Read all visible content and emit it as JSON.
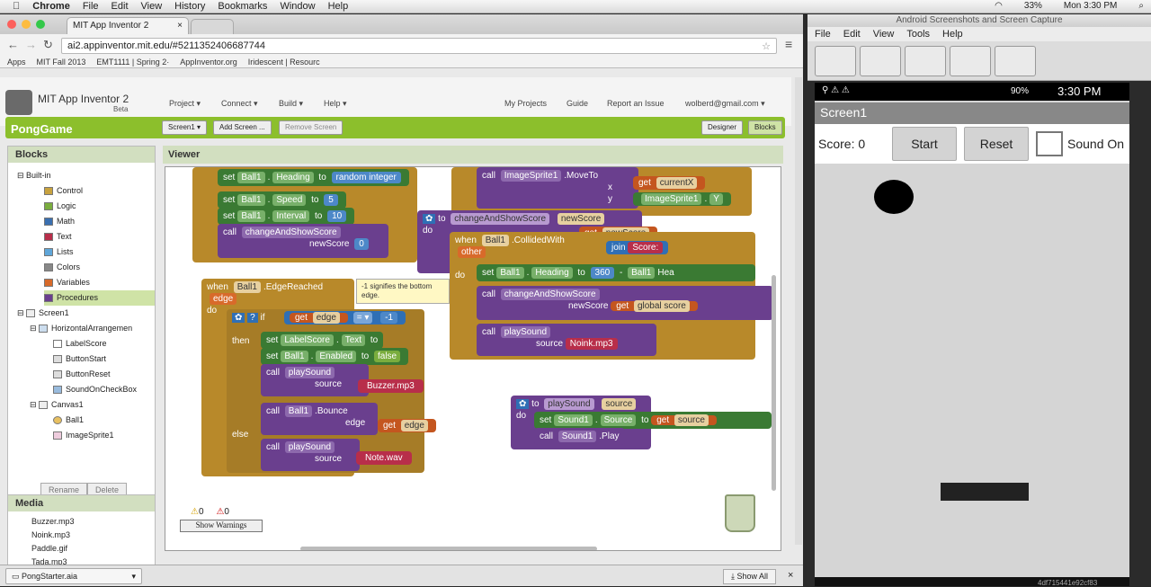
{
  "menubar": {
    "app": "Chrome",
    "items": [
      "File",
      "Edit",
      "View",
      "History",
      "Bookmarks",
      "Window",
      "Help"
    ],
    "battery": "33%",
    "clock": "Mon 3:30 PM"
  },
  "browser": {
    "tab_title": "MIT App Inventor 2",
    "url": "ai2.appinventor.mit.edu/#5211352406687744",
    "bookmarks": [
      "Apps",
      "MIT Fall 2013",
      "EMT1111 | Spring 2·",
      "AppInventor.org",
      "Iridescent | Resourc"
    ],
    "download_file": "PongStarter.aia",
    "show_all": "Show All"
  },
  "ai": {
    "title": "MIT App Inventor 2",
    "beta": "Beta",
    "menus": [
      "Project ▾",
      "Connect ▾",
      "Build ▾",
      "Help ▾"
    ],
    "right_links": [
      "My Projects",
      "Guide",
      "Report an Issue",
      "wolberd@gmail.com ▾"
    ],
    "project": "PongGame",
    "screen_dd": "Screen1 ▾",
    "add_screen": "Add Screen ...",
    "remove_screen": "Remove Screen",
    "designer": "Designer",
    "blocks": "Blocks"
  },
  "blocks_panel": {
    "title": "Blocks",
    "builtin": "Built-in",
    "categories": [
      {
        "name": "Control",
        "color": "#c8a23e"
      },
      {
        "name": "Logic",
        "color": "#7aad3e"
      },
      {
        "name": "Math",
        "color": "#3a6fb0"
      },
      {
        "name": "Text",
        "color": "#b82e4a"
      },
      {
        "name": "Lists",
        "color": "#5fa6d9"
      },
      {
        "name": "Colors",
        "color": "#888888"
      },
      {
        "name": "Variables",
        "color": "#d86a2a"
      },
      {
        "name": "Procedures",
        "color": "#6a3f8e"
      }
    ],
    "screen": "Screen1",
    "harr": "HorizontalArrangemen",
    "items": [
      "LabelScore",
      "ButtonStart",
      "ButtonReset",
      "SoundOnCheckBox"
    ],
    "canvas": "Canvas1",
    "canvas_items": [
      "Ball1",
      "ImageSprite1"
    ],
    "rename": "Rename",
    "delete": "Delete"
  },
  "media": {
    "title": "Media",
    "files": [
      "Buzzer.mp3",
      "Noink.mp3",
      "Paddle.gif",
      "Tada.mp3"
    ]
  },
  "viewer": {
    "title": "Viewer",
    "warn_count": "0",
    "err_count": "0",
    "show_warnings": "Show Warnings"
  },
  "code": {
    "set": "set",
    "call": "call",
    "get": "get",
    "to": "to",
    "when": "when",
    "do": "do",
    "if": "if",
    "then": "then",
    "else": "else",
    "other": "other",
    "ball1": "Ball1",
    "heading": "Heading",
    "speed": "Speed",
    "interval": "Interval",
    "random": "random integer",
    "five": "5",
    "ten": "10",
    "zero": "0",
    "csh": "changeAndShowScore",
    "newscore": "newScore",
    "edgereached": ".EdgeReached",
    "edge": "edge",
    "neg1": "-1",
    "eq": "= ▾",
    "comment": "-1 signifies the bottom edge.",
    "labelscore": "LabelScore",
    "text": "Text",
    "enabled": "Enabled",
    "false": "false",
    "playsound": "playSound",
    "source": "source",
    "buzzer": "Buzzer.mp3",
    "bounce": ".Bounce",
    "notewav": "Note.wav",
    "collided": ".CollidedWith",
    "n360": "360",
    "join": "join",
    "score": "Score:",
    "globalscore": "global score",
    "noink": "Noink.mp3",
    "moveto": ".MoveTo",
    "imgsprite": "ImageSprite1",
    "x": "x",
    "y": "y",
    "currentx": "currentX",
    "Y": "Y",
    "sound1": "Sound1",
    "source2": "Source",
    "play": ".Play",
    "heading2": "Hea",
    "global_score_tail": "global score",
    "new_score_tail": "newScore"
  },
  "emulator": {
    "title": "Android Screenshots and Screen Capture",
    "menu": [
      "File",
      "Edit",
      "View",
      "Tools",
      "Help"
    ],
    "clock": "3:30 PM",
    "battery": "90%",
    "screen_title": "Screen1",
    "score": "Score: 0",
    "start": "Start",
    "reset": "Reset",
    "soundon": "Sound On",
    "serial": "4df715441e92cf83"
  }
}
